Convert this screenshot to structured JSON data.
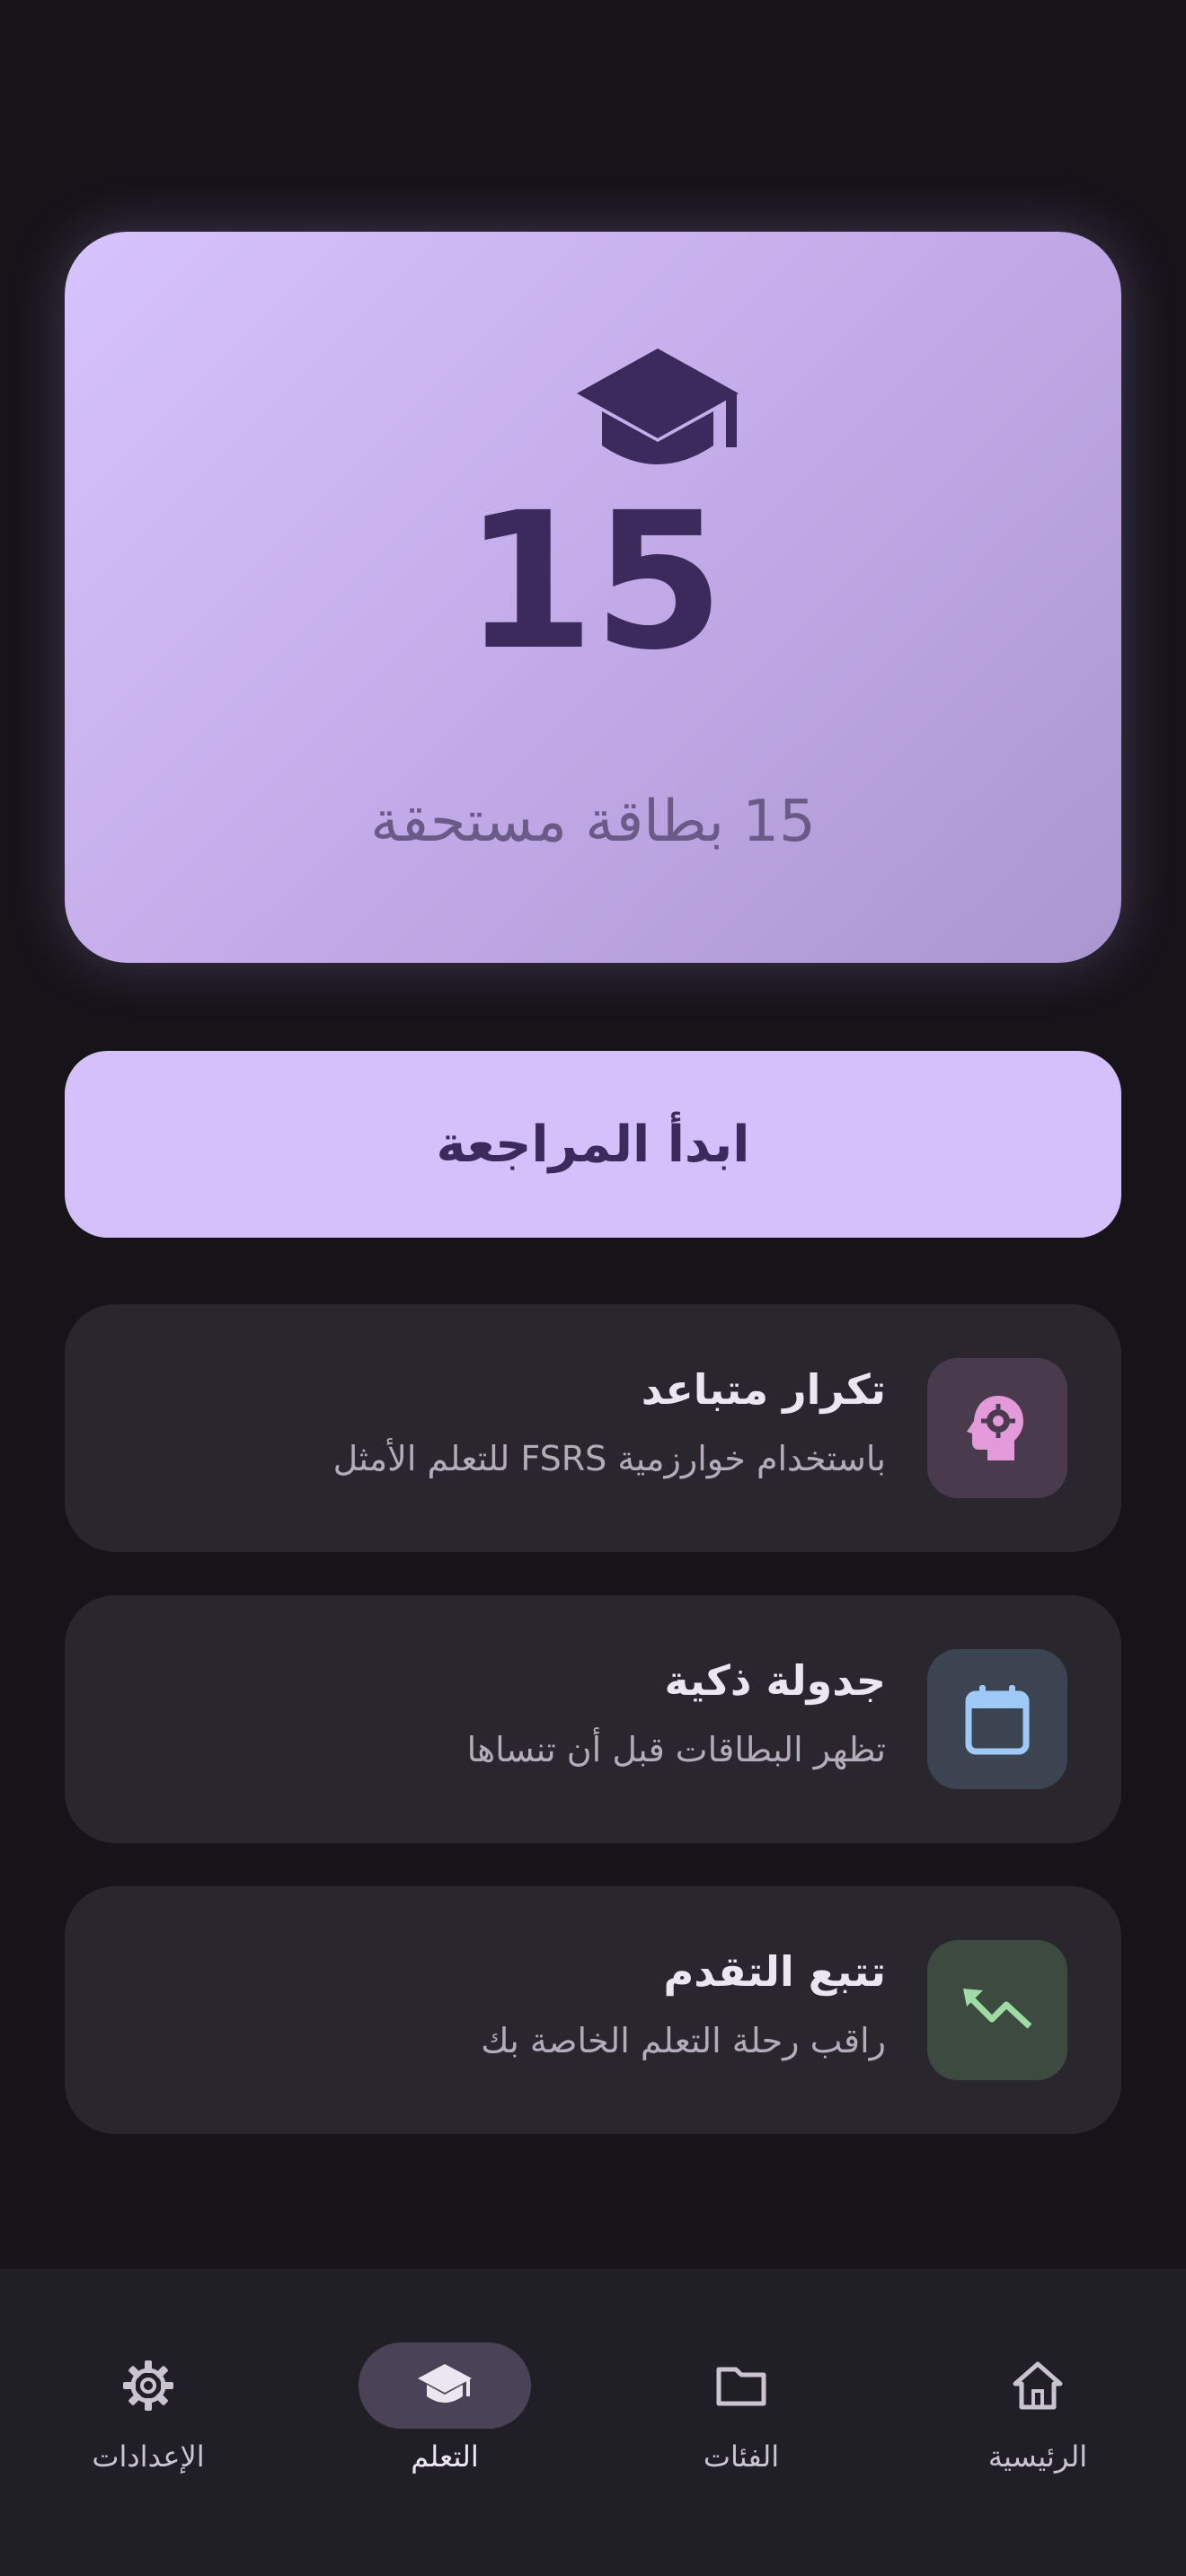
{
  "hero": {
    "count": "15",
    "subtitle": "15 بطاقة مستحقة",
    "icon": "graduation-cap-icon",
    "colors": {
      "gradient_start": "#d7c3fb",
      "gradient_end": "#ab96d0",
      "text": "#3c2a5c"
    }
  },
  "start_button": {
    "label": "ابدأ المراجعة",
    "color": "#d6c0fb"
  },
  "features": [
    {
      "title": "تكرار متباعد",
      "description": "باستخدام خوارزمية FSRS للتعلم الأمثل",
      "icon": "psychology-head-icon",
      "icon_bg": "#4a3a4e",
      "icon_color": "#e39ad8"
    },
    {
      "title": "جدولة ذكية",
      "description": "تظهر البطاقات قبل أن تنساها",
      "icon": "calendar-icon",
      "icon_bg": "#3c4452",
      "icon_color": "#9fcaf8"
    },
    {
      "title": "تتبع التقدم",
      "description": "راقب رحلة التعلم الخاصة بك",
      "icon": "trending-up-icon",
      "icon_bg": "#3c4a40",
      "icon_color": "#9fdba4"
    }
  ],
  "bottom_nav": {
    "items": [
      {
        "label": "الإعدادات",
        "icon": "gear-icon",
        "active": false
      },
      {
        "label": "التعلم",
        "icon": "graduation-cap-icon",
        "active": true
      },
      {
        "label": "الفئات",
        "icon": "folder-icon",
        "active": false
      },
      {
        "label": "الرئيسية",
        "icon": "home-icon",
        "active": false
      }
    ]
  }
}
